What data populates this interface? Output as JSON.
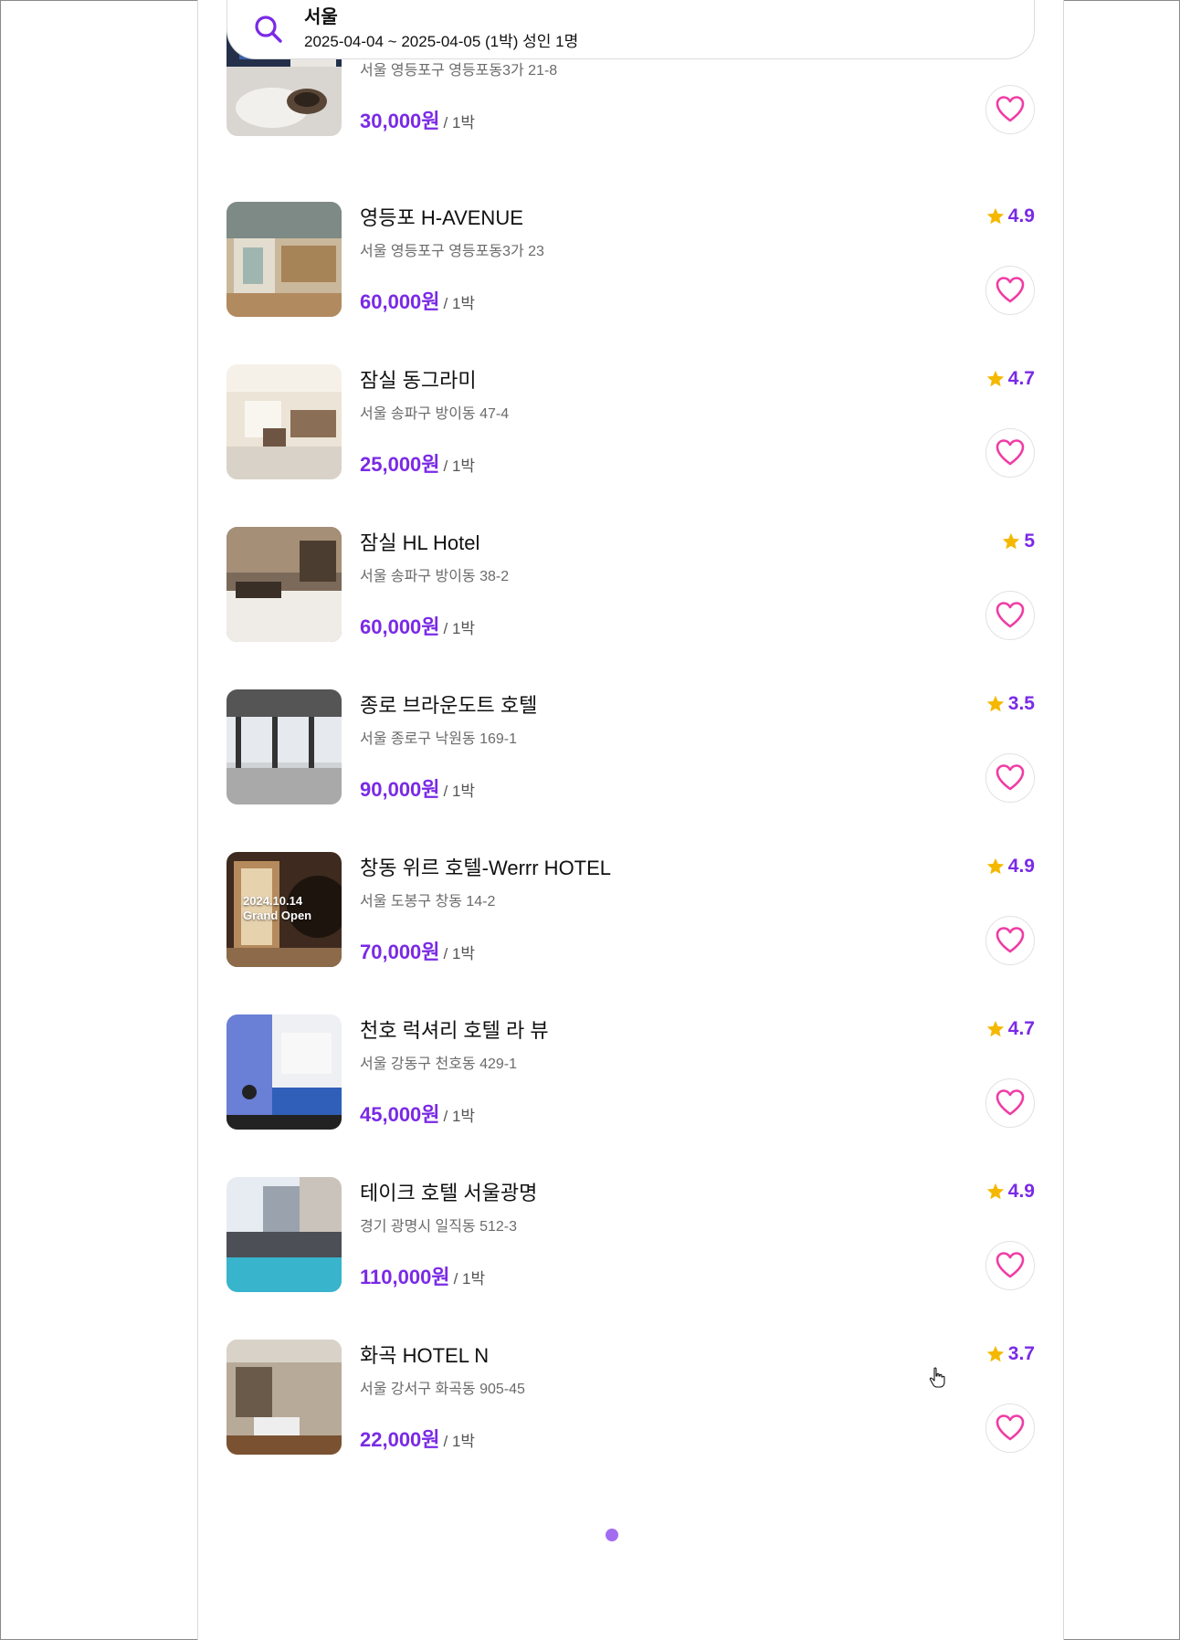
{
  "search": {
    "location": "서울",
    "detail": "2025-04-04 ~ 2025-04-05 (1박) 성인 1명"
  },
  "colors": {
    "accent": "#7a2ae6",
    "star": "#f5b800",
    "heart": "#f03ca5"
  },
  "listings": [
    {
      "name": "",
      "address": "서울 영등포구 영등포동3가 21-8",
      "price": "30,000원",
      "per_night": "/ 1박",
      "rating": ""
    },
    {
      "name": "영등포 H-AVENUE",
      "address": "서울 영등포구 영등포동3가 23",
      "price": "60,000원",
      "per_night": "/ 1박",
      "rating": "4.9"
    },
    {
      "name": "잠실 동그라미",
      "address": "서울 송파구 방이동 47-4",
      "price": "25,000원",
      "per_night": "/ 1박",
      "rating": "4.7"
    },
    {
      "name": "잠실 HL Hotel",
      "address": "서울 송파구 방이동 38-2",
      "price": "60,000원",
      "per_night": "/ 1박",
      "rating": "5"
    },
    {
      "name": "종로 브라운도트 호텔",
      "address": "서울 종로구 낙원동 169-1",
      "price": "90,000원",
      "per_night": "/ 1박",
      "rating": "3.5"
    },
    {
      "name": "창동 위르 호텔-Werrr HOTEL",
      "address": "서울 도봉구 창동 14-2",
      "price": "70,000원",
      "per_night": "/ 1박",
      "rating": "4.9",
      "image_caption": [
        "2024.10.14",
        "Grand Open"
      ]
    },
    {
      "name": "천호 럭셔리 호텔 라 뷰",
      "address": "서울 강동구 천호동 429-1",
      "price": "45,000원",
      "per_night": "/ 1박",
      "rating": "4.7"
    },
    {
      "name": "테이크 호텔 서울광명",
      "address": "경기 광명시 일직동 512-3",
      "price": "110,000원",
      "per_night": "/ 1박",
      "rating": "4.9"
    },
    {
      "name": "화곡 HOTEL N",
      "address": "서울 강서구 화곡동 905-45",
      "price": "22,000원",
      "per_night": "/ 1박",
      "rating": "3.7"
    }
  ],
  "pagination": {
    "active_index": 0,
    "count": 1
  }
}
